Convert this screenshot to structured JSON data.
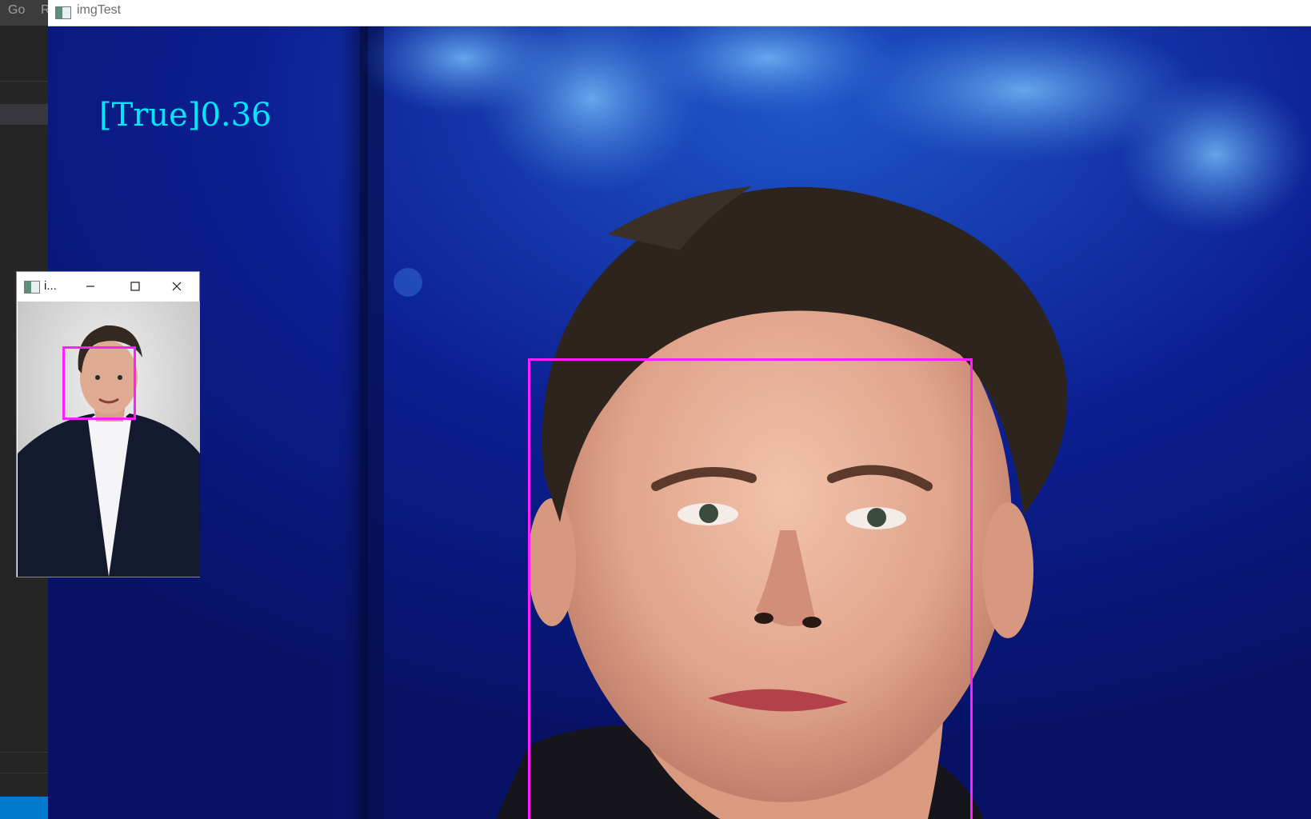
{
  "ide": {
    "menu": [
      "Go",
      "R"
    ]
  },
  "main_window": {
    "title": "imgTest",
    "icon": "app-window-icon",
    "overlay_text": "[True]0.36",
    "overlay_color": "#00e8ff",
    "face_box_color": "#ff1fff"
  },
  "preview_window": {
    "title": "i...",
    "icon": "app-window-icon",
    "buttons": {
      "minimize_icon": "minimize-icon",
      "maximize_icon": "maximize-icon",
      "close_icon": "close-icon"
    },
    "face_box_color": "#ff1fff"
  },
  "colors": {
    "scene_background": "#0a1a7a",
    "status_bar": "#007acc"
  }
}
